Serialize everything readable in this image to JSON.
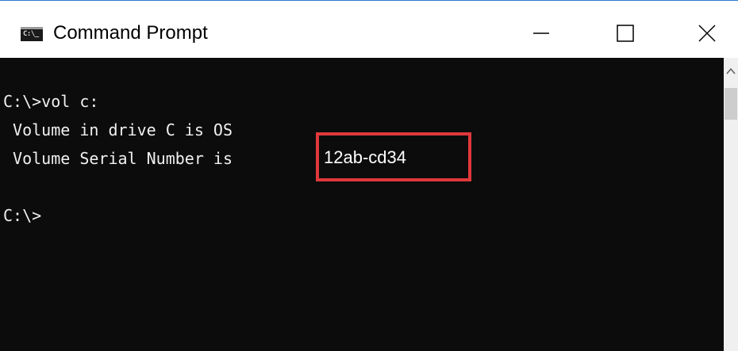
{
  "window": {
    "title": "Command Prompt",
    "icon_label": "C:\\_",
    "controls": {
      "minimize": "minimize-icon",
      "maximize": "maximize-icon",
      "close": "close-icon"
    }
  },
  "console": {
    "lines": [
      "C:\\>vol c:",
      " Volume in drive C is OS",
      " Volume Serial Number is ",
      "C:\\>"
    ],
    "serial_number": "12ab-cd34",
    "highlight_color": "#e0383b"
  },
  "colors": {
    "console_bg": "#0c0c0c",
    "console_text": "#f0f0f0",
    "window_border": "#2b78d0"
  }
}
